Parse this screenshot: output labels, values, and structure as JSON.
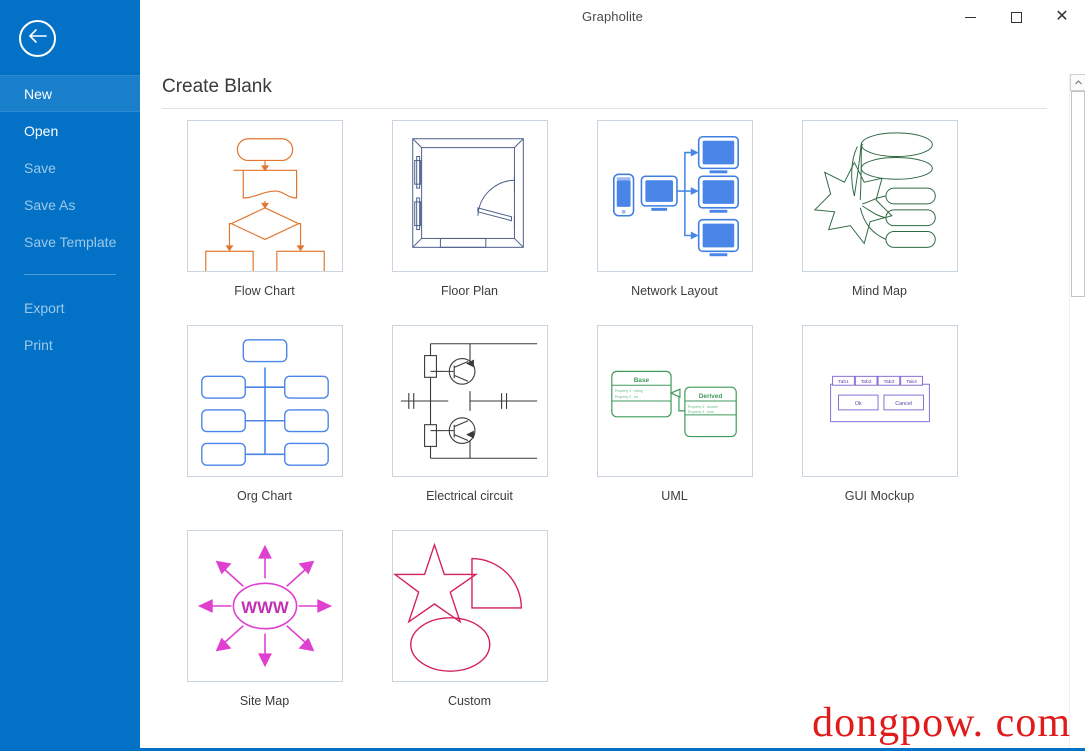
{
  "window": {
    "title": "Grapholite",
    "minimize_label": "Minimize",
    "maximize_label": "Maximize",
    "close_label": "Close"
  },
  "sidebar": {
    "back_label": "Back",
    "accent_color": "#0372c6",
    "items": [
      {
        "label": "New",
        "state": "active"
      },
      {
        "label": "Open",
        "state": "enabled"
      },
      {
        "label": "Save",
        "state": "disabled"
      },
      {
        "label": "Save As",
        "state": "disabled"
      },
      {
        "label": "Save Template",
        "state": "disabled"
      },
      {
        "label": "Export",
        "state": "disabled"
      },
      {
        "label": "Print",
        "state": "disabled"
      }
    ]
  },
  "main": {
    "heading": "Create Blank",
    "templates": [
      {
        "label": "Flow Chart",
        "color": "#e2762e"
      },
      {
        "label": "Floor Plan",
        "color": "#4a5f8a"
      },
      {
        "label": "Network Layout",
        "color": "#3f7fe0"
      },
      {
        "label": "Mind Map",
        "color": "#2f6b43"
      },
      {
        "label": "Org Chart",
        "color": "#3f7fd1"
      },
      {
        "label": "Electrical circuit",
        "color": "#3a3a3a"
      },
      {
        "label": "UML",
        "color": "#3f9a5c"
      },
      {
        "label": "GUI Mockup",
        "color": "#7b5fd1"
      },
      {
        "label": "Site Map",
        "color": "#e040d0"
      },
      {
        "label": "Custom",
        "color": "#d4215c"
      }
    ],
    "uml": {
      "base_title": "Base",
      "base_prop1": "Property 1 : string",
      "base_prop2": "Property 2 : int",
      "derived_title": "Derived",
      "derived_prop1": "Property 3 : double",
      "derived_prop2": "Property 4 : bool"
    },
    "gui_mockup": {
      "tabs": [
        "Tab1",
        "Tab2",
        "Tab3",
        "Tab4"
      ],
      "ok_label": "Ok",
      "cancel_label": "Cancel"
    },
    "site_map": {
      "center_label": "WWW"
    }
  },
  "scrollbar": {
    "up_arrow": "scroll-up"
  },
  "watermark": {
    "text": "dongpow. com",
    "color": "#e01b1b"
  }
}
